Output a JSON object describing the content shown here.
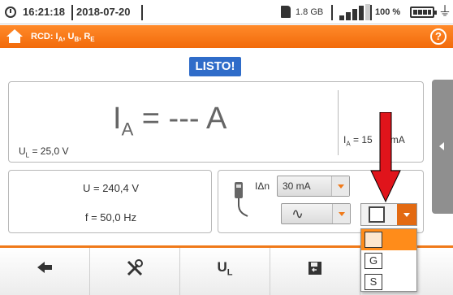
{
  "statusbar": {
    "time": "16:21:18",
    "date": "2018-07-20",
    "storage": "1.8 GB",
    "battery_percent": "100 %",
    "signal_bars_filled": 4,
    "signal_bars_total": 5
  },
  "titlebar": {
    "title_prefix": "RCD: I",
    "title_sub_a": "A",
    "title_mid1": ", U",
    "title_sub_b": "B",
    "title_mid2": ", R",
    "title_sub_e": "E",
    "help": "?",
    "color": "#f26a0a"
  },
  "status_badge": "LISTO!",
  "main": {
    "reading_prefix": "I",
    "reading_sub": "A",
    "reading_suffix": " = --- A",
    "ul_prefix": "U",
    "ul_sub": "L",
    "ul_suffix": " = 25,0 V",
    "ia_prefix": "I",
    "ia_sub": "A",
    "ia_suffix": " = 15",
    "ia_tail": "0 mA"
  },
  "measurements": {
    "voltage": "U = 240,4 V",
    "frequency": "f = 50,0 Hz"
  },
  "settings": {
    "idn_label": "IΔn",
    "current_value": "30 mA",
    "waveform_icon": "sine-wave-icon",
    "waveform_glyph": "∿",
    "rcd_type_icon": "empty-square-icon"
  },
  "dropdown": {
    "options": [
      "",
      "G",
      "S"
    ],
    "selected_index": 0
  },
  "toolbar": {
    "buttons": [
      "back-icon",
      "tools-icon",
      "UL",
      "save-icon",
      "extra-icon"
    ],
    "ul_label": "U",
    "ul_sub": "L"
  },
  "colors": {
    "accent": "#f07a1a",
    "badge": "#2f6cc9",
    "arrow": "#e0141b"
  }
}
